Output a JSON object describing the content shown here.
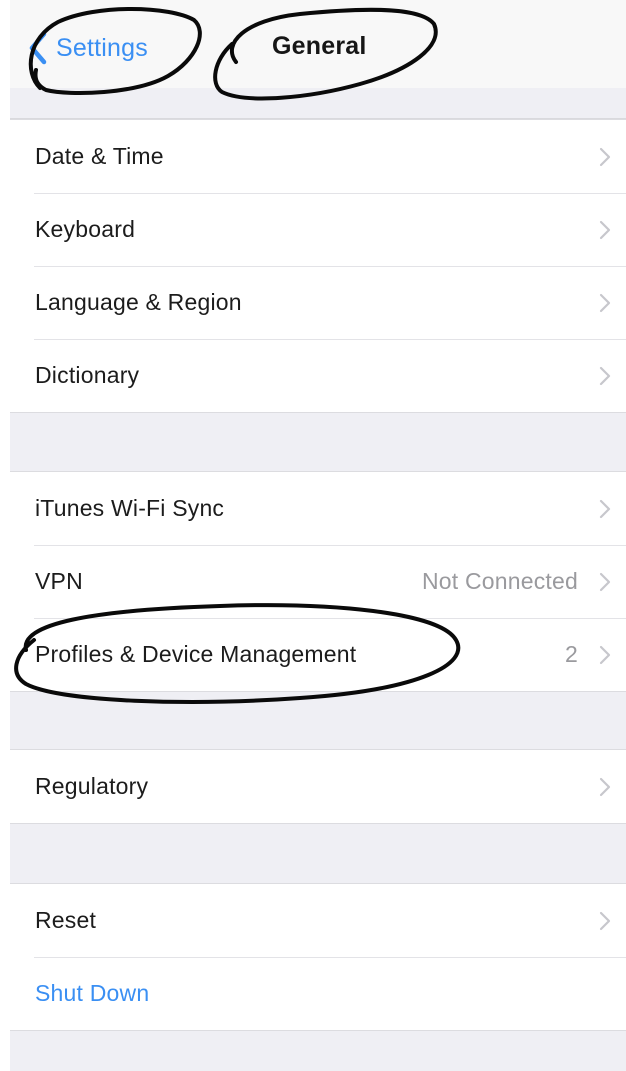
{
  "navbar": {
    "back_label": "Settings",
    "title": "General"
  },
  "groups": [
    {
      "rows": [
        {
          "label": "Date & Time",
          "detail": ""
        },
        {
          "label": "Keyboard",
          "detail": ""
        },
        {
          "label": "Language & Region",
          "detail": ""
        },
        {
          "label": "Dictionary",
          "detail": ""
        }
      ]
    },
    {
      "rows": [
        {
          "label": "iTunes Wi-Fi Sync",
          "detail": ""
        },
        {
          "label": "VPN",
          "detail": "Not Connected"
        },
        {
          "label": "Profiles & Device Management",
          "detail": "2"
        }
      ]
    },
    {
      "rows": [
        {
          "label": "Regulatory",
          "detail": ""
        }
      ]
    },
    {
      "rows": [
        {
          "label": "Reset",
          "detail": ""
        },
        {
          "label": "Shut Down",
          "detail": ""
        }
      ]
    }
  ],
  "icons": {
    "back": "chevron-left-icon",
    "disclosure": "chevron-right-icon"
  },
  "colors": {
    "accent": "#3a8ff3",
    "background": "#efeff4",
    "annotation_ink": "#0a0a0a"
  }
}
